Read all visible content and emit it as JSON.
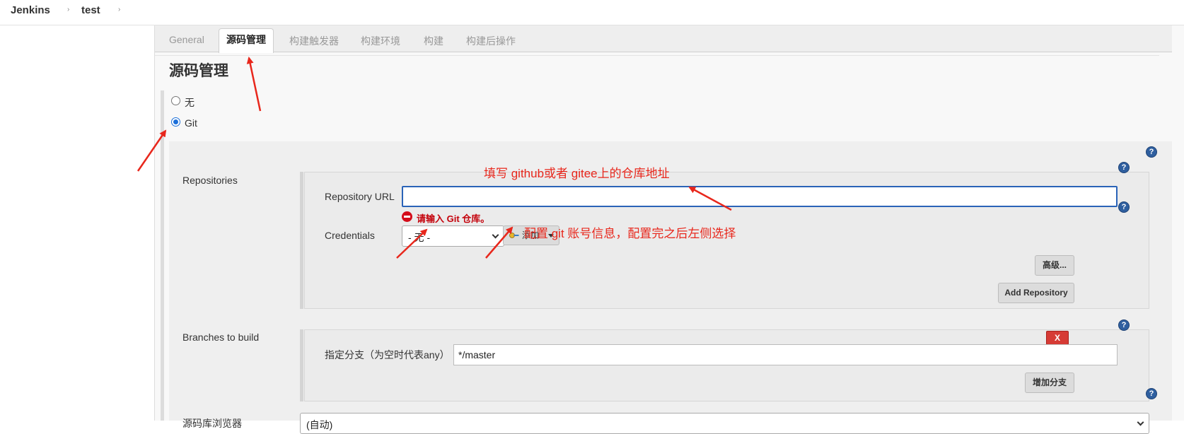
{
  "breadcrumb": {
    "root": "Jenkins",
    "job": "test",
    "sep": "›"
  },
  "tabs": [
    {
      "label": "General"
    },
    {
      "label": "源码管理"
    },
    {
      "label": "构建触发器"
    },
    {
      "label": "构建环境"
    },
    {
      "label": "构建"
    },
    {
      "label": "构建后操作"
    }
  ],
  "scm": {
    "title": "源码管理",
    "option_none": "无",
    "option_git": "Git",
    "selected": "Git"
  },
  "repositories": {
    "label": "Repositories",
    "url_label": "Repository URL",
    "url_value": "",
    "url_error": "请输入 Git 仓库。",
    "credentials_label": "Credentials",
    "credentials_value": "- 无 -",
    "add_button": "添加",
    "advanced_button": "高级...",
    "add_repository_button": "Add Repository"
  },
  "branches": {
    "label": "Branches to build",
    "spec_label": "指定分支（为空时代表any）",
    "spec_value": "*/master",
    "delete_button": "X",
    "add_branch_button": "增加分支"
  },
  "browser": {
    "label": "源码库浏览器",
    "value": "(自动)"
  },
  "help_glyph": "?",
  "annotations": {
    "url_hint": "填写 github或者 gitee上的仓库地址",
    "credentials_hint": "配置 git 账号信息，配置完之后左侧选择"
  },
  "colors": {
    "annotation": "#e8271c",
    "error": "#c4000a",
    "focus": "#2a63b8",
    "radio_selected": "#1b6fd9",
    "help_icon": "#2f5f9f"
  }
}
